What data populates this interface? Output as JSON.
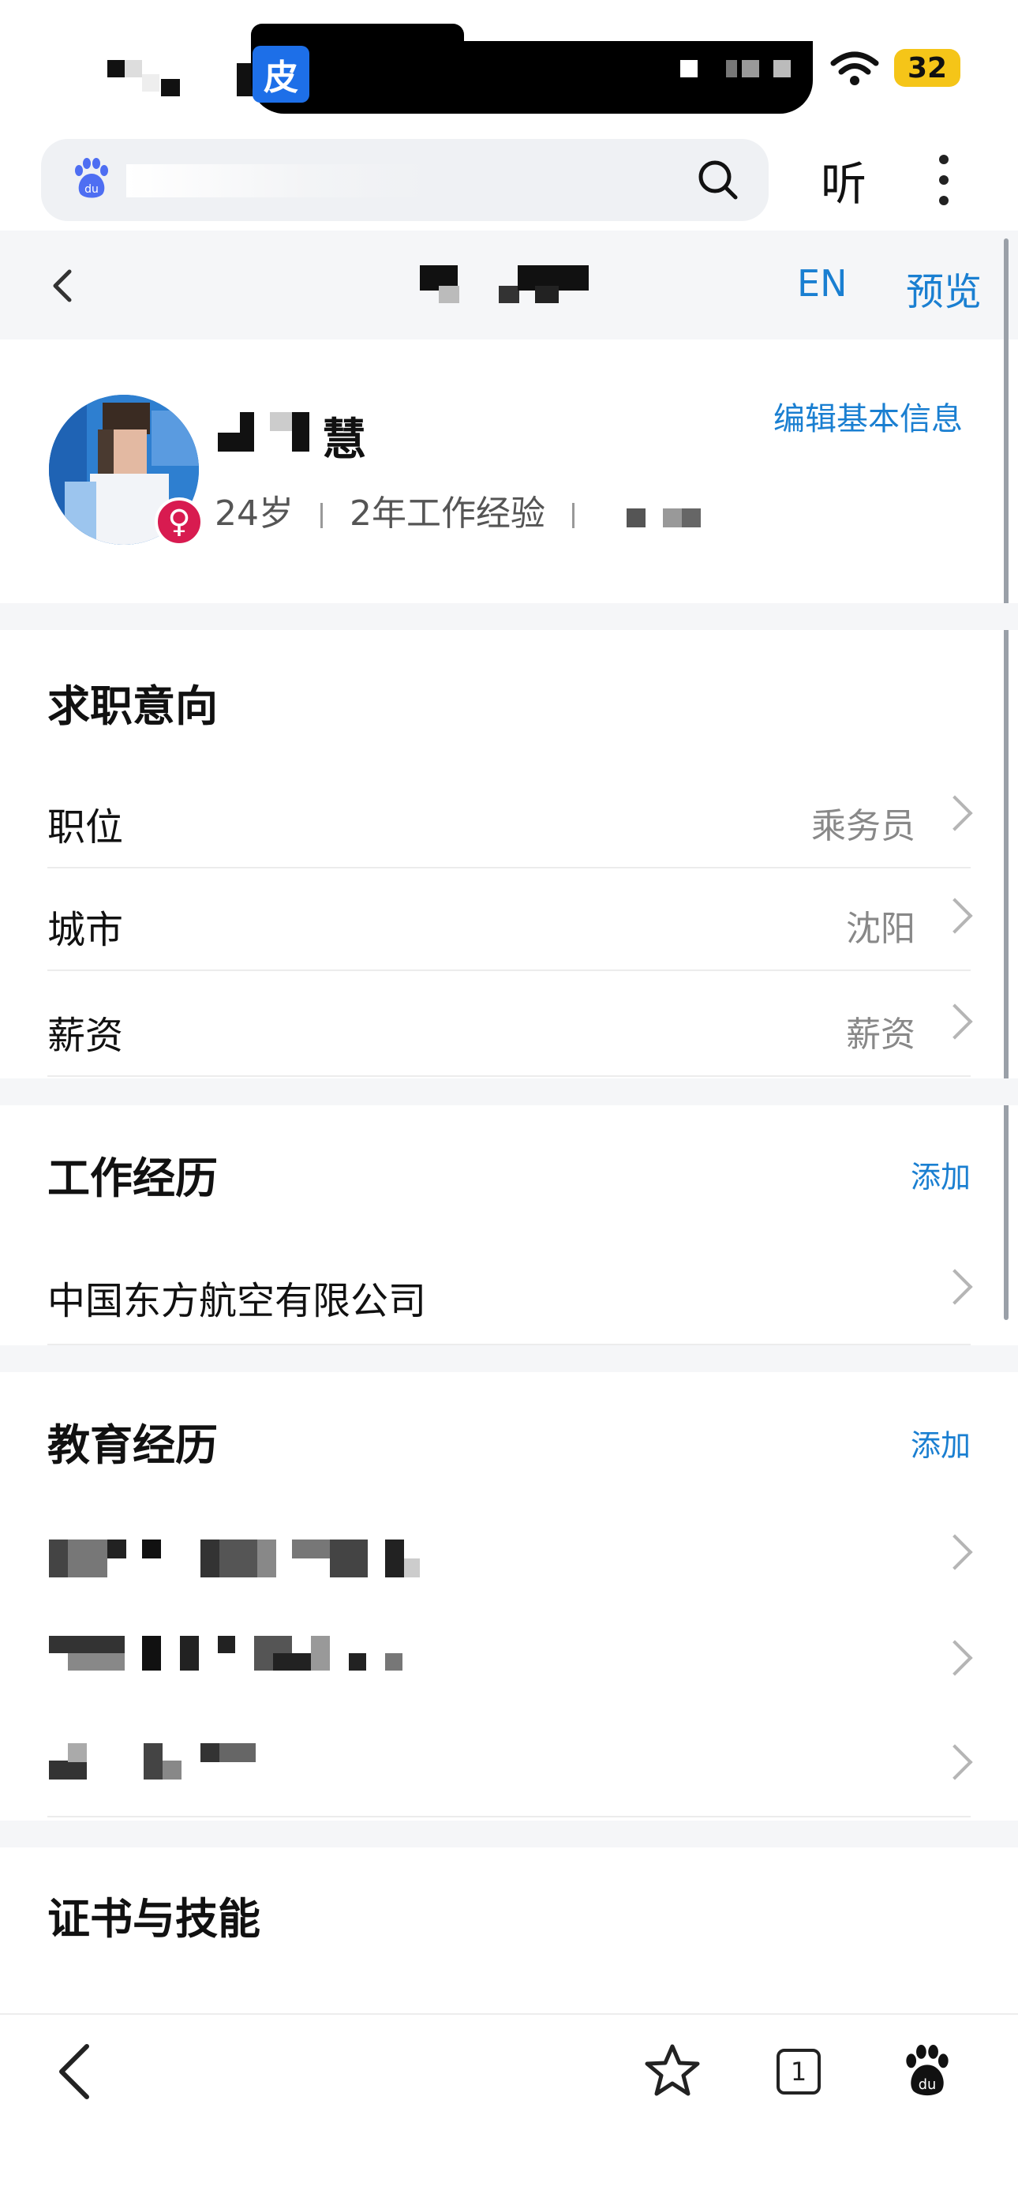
{
  "status_bar": {
    "app_badge": "皮",
    "battery": "32"
  },
  "search": {
    "placeholder": ""
  },
  "toolbar": {
    "listen_label": "听"
  },
  "nav": {
    "en_label": "EN",
    "preview_label": "预览"
  },
  "profile": {
    "name_suffix": "慧",
    "age": "24岁",
    "experience": "2年工作经验",
    "edit_label": "编辑基本信息",
    "gender_symbol": "♀"
  },
  "job_intent": {
    "title": "求职意向",
    "rows": [
      {
        "label": "职位",
        "value": "乘务员"
      },
      {
        "label": "城市",
        "value": "沈阳"
      },
      {
        "label": "薪资",
        "value": "薪资"
      }
    ]
  },
  "work": {
    "title": "工作经历",
    "add_label": "添加",
    "items": [
      "中国东方航空有限公司"
    ]
  },
  "education": {
    "title": "教育经历",
    "add_label": "添加"
  },
  "certificates": {
    "title": "证书与技能"
  },
  "bottom_bar": {
    "tab_count": "1"
  },
  "colors": {
    "accent": "#1a7fd1",
    "gender_badge": "#d81b50",
    "battery": "#f5c518"
  }
}
